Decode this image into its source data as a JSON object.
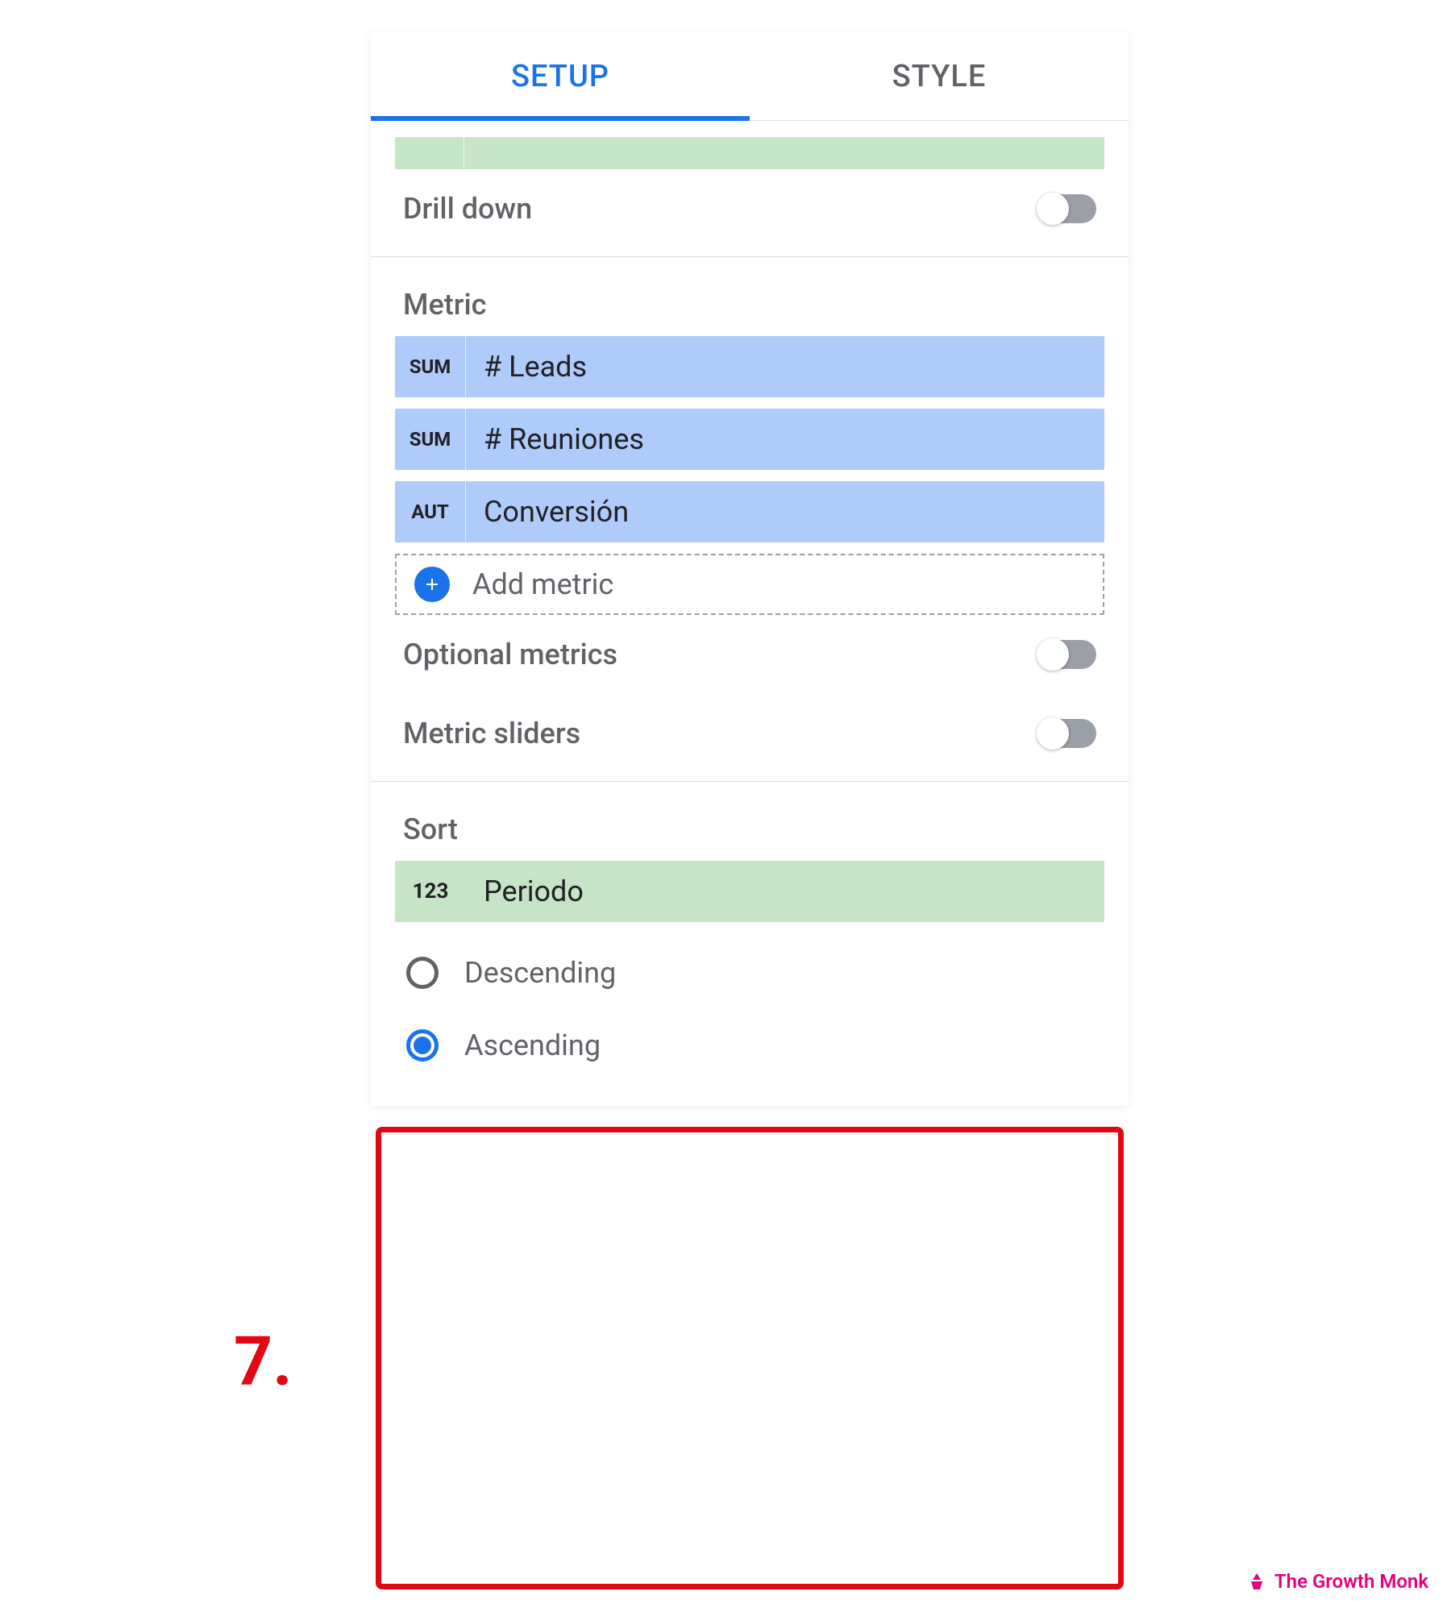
{
  "tabs": {
    "setup": "SETUP",
    "style": "STYLE"
  },
  "drill_down": {
    "label": "Drill down",
    "enabled": false
  },
  "metric_section": {
    "title": "Metric",
    "items": [
      {
        "agg": "SUM",
        "label": "# Leads"
      },
      {
        "agg": "SUM",
        "label": "# Reuniones"
      },
      {
        "agg": "AUT",
        "label": "Conversión"
      }
    ],
    "add_label": "Add metric"
  },
  "optional_metrics": {
    "label": "Optional metrics",
    "enabled": false
  },
  "metric_sliders": {
    "label": "Metric sliders",
    "enabled": false
  },
  "sort_section": {
    "title": "Sort",
    "field_type": "123",
    "field_label": "Periodo",
    "options": {
      "descending": "Descending",
      "ascending": "Ascending"
    },
    "selected": "ascending"
  },
  "annotation": "7.",
  "watermark": "The Growth Monk"
}
